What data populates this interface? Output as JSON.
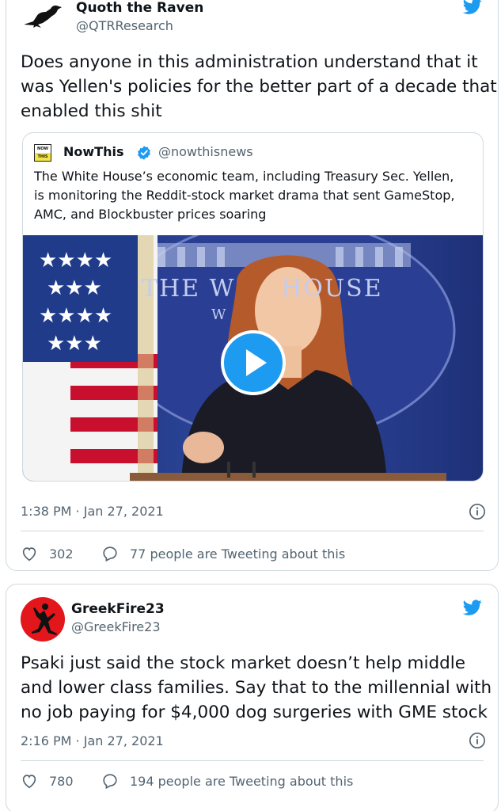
{
  "tweets": [
    {
      "author_name": "Quoth the Raven",
      "author_handle": "@QTRResearch",
      "text_lines": [
        "Does anyone in this administration understand that it",
        "was Yellen's policies for the better part of a decade that",
        "enabled this shit"
      ],
      "timestamp": "1:38 PM · Jan 27, 2021",
      "like_count": "302",
      "reply_label": "77 people are Tweeting about this",
      "quoted": {
        "logo_text": "NOW THIS",
        "author_name": "NowThis",
        "author_handle": "@nowthisnews",
        "verified": true,
        "text_lines": [
          "The White House’s economic team, including Treasury Sec. Yellen,",
          "is monitoring the Reddit-stock market drama that sent GameStop,",
          "AMC, and Blockbuster prices soaring"
        ],
        "video_overlay_text": "THE W     HOUSE",
        "video_overlay_text2": "W"
      }
    },
    {
      "author_name": "GreekFire23",
      "author_handle": "@GreekFire23",
      "text_lines": [
        "Psaki just said the stock market doesn’t help middle",
        "and lower class families. Say that to the millennial with",
        "no job paying for $4,000 dog surgeries with GME stock"
      ],
      "timestamp": "2:16 PM · Jan 27, 2021",
      "like_count": "780",
      "reply_label": "194 people are Tweeting about this"
    }
  ],
  "colors": {
    "twitter_blue": "#1d9bf0",
    "text_primary": "#0f1419",
    "text_secondary": "#536471",
    "border": "#cfd9de",
    "avatar2_bg": "#e3161b"
  },
  "icons": [
    "raven-icon",
    "twitter-bird-icon",
    "verified-badge-icon",
    "heart-icon",
    "reply-icon",
    "info-icon",
    "play-icon",
    "jumpman-icon"
  ]
}
